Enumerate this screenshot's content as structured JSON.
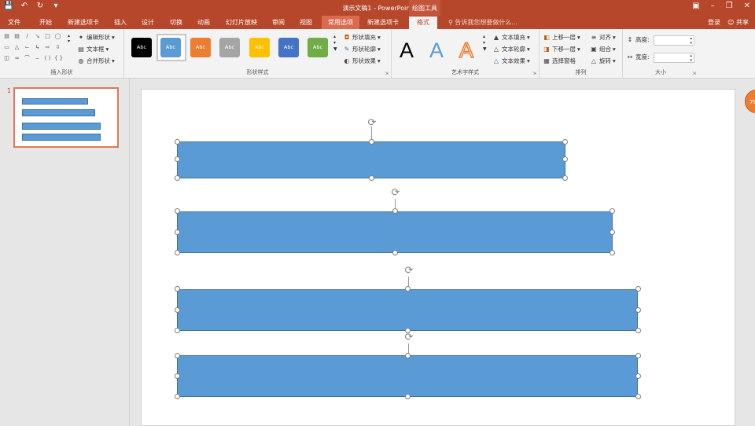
{
  "titlebar": {
    "title": "演示文稿1 - PowerPoint",
    "context_tab": "绘图工具",
    "qat": [
      "save-icon",
      "undo-icon",
      "redo-icon",
      "customize-icon"
    ],
    "controls": [
      "ribbon-display-icon",
      "minimize-icon",
      "restore-icon",
      "close-icon"
    ]
  },
  "tabs": {
    "file": "文件",
    "items": [
      "开始",
      "新建选项卡",
      "插入",
      "设计",
      "切换",
      "动画",
      "幻灯片放映",
      "审阅",
      "视图",
      "常用选项",
      "新建选项卡",
      "格式"
    ],
    "highlighted": "常用选项",
    "active": "格式",
    "tell_me": "告诉我您想要做什么...",
    "login": "登录",
    "share": "共享"
  },
  "ribbon": {
    "insert_shapes": {
      "label": "插入形状",
      "edit_shape": "编辑形状",
      "text_box": "文本框",
      "merge_shapes": "合并形状"
    },
    "shape_styles": {
      "label": "形状样式",
      "swatch_text": "Abc",
      "swatches": [
        {
          "color": "#000000"
        },
        {
          "color": "#5b9bd5"
        },
        {
          "color": "#ed7d31"
        },
        {
          "color": "#a5a5a5"
        },
        {
          "color": "#ffc000"
        },
        {
          "color": "#4472c4"
        },
        {
          "color": "#70ad47"
        }
      ],
      "fill": "形状填充",
      "outline": "形状轮廓",
      "effects": "形状效果"
    },
    "wordart": {
      "label": "艺术字样式",
      "letter": "A",
      "text_fill": "文本填充",
      "text_outline": "文本轮廓",
      "text_effects": "文本效果"
    },
    "arrange": {
      "label": "排列",
      "bring_forward": "上移一层",
      "send_backward": "下移一层",
      "selection_pane": "选择窗格",
      "align": "对齐",
      "group": "组合",
      "rotate": "旋转"
    },
    "size": {
      "label": "大小",
      "height": "高度:",
      "width": "宽度:",
      "height_value": "",
      "width_value": ""
    }
  },
  "slides_panel": {
    "slide_number": "1"
  },
  "badge": "78",
  "colors": {
    "accent": "#b7472a",
    "shape_fill": "#5b9bd5",
    "shape_border": "#41719c"
  }
}
